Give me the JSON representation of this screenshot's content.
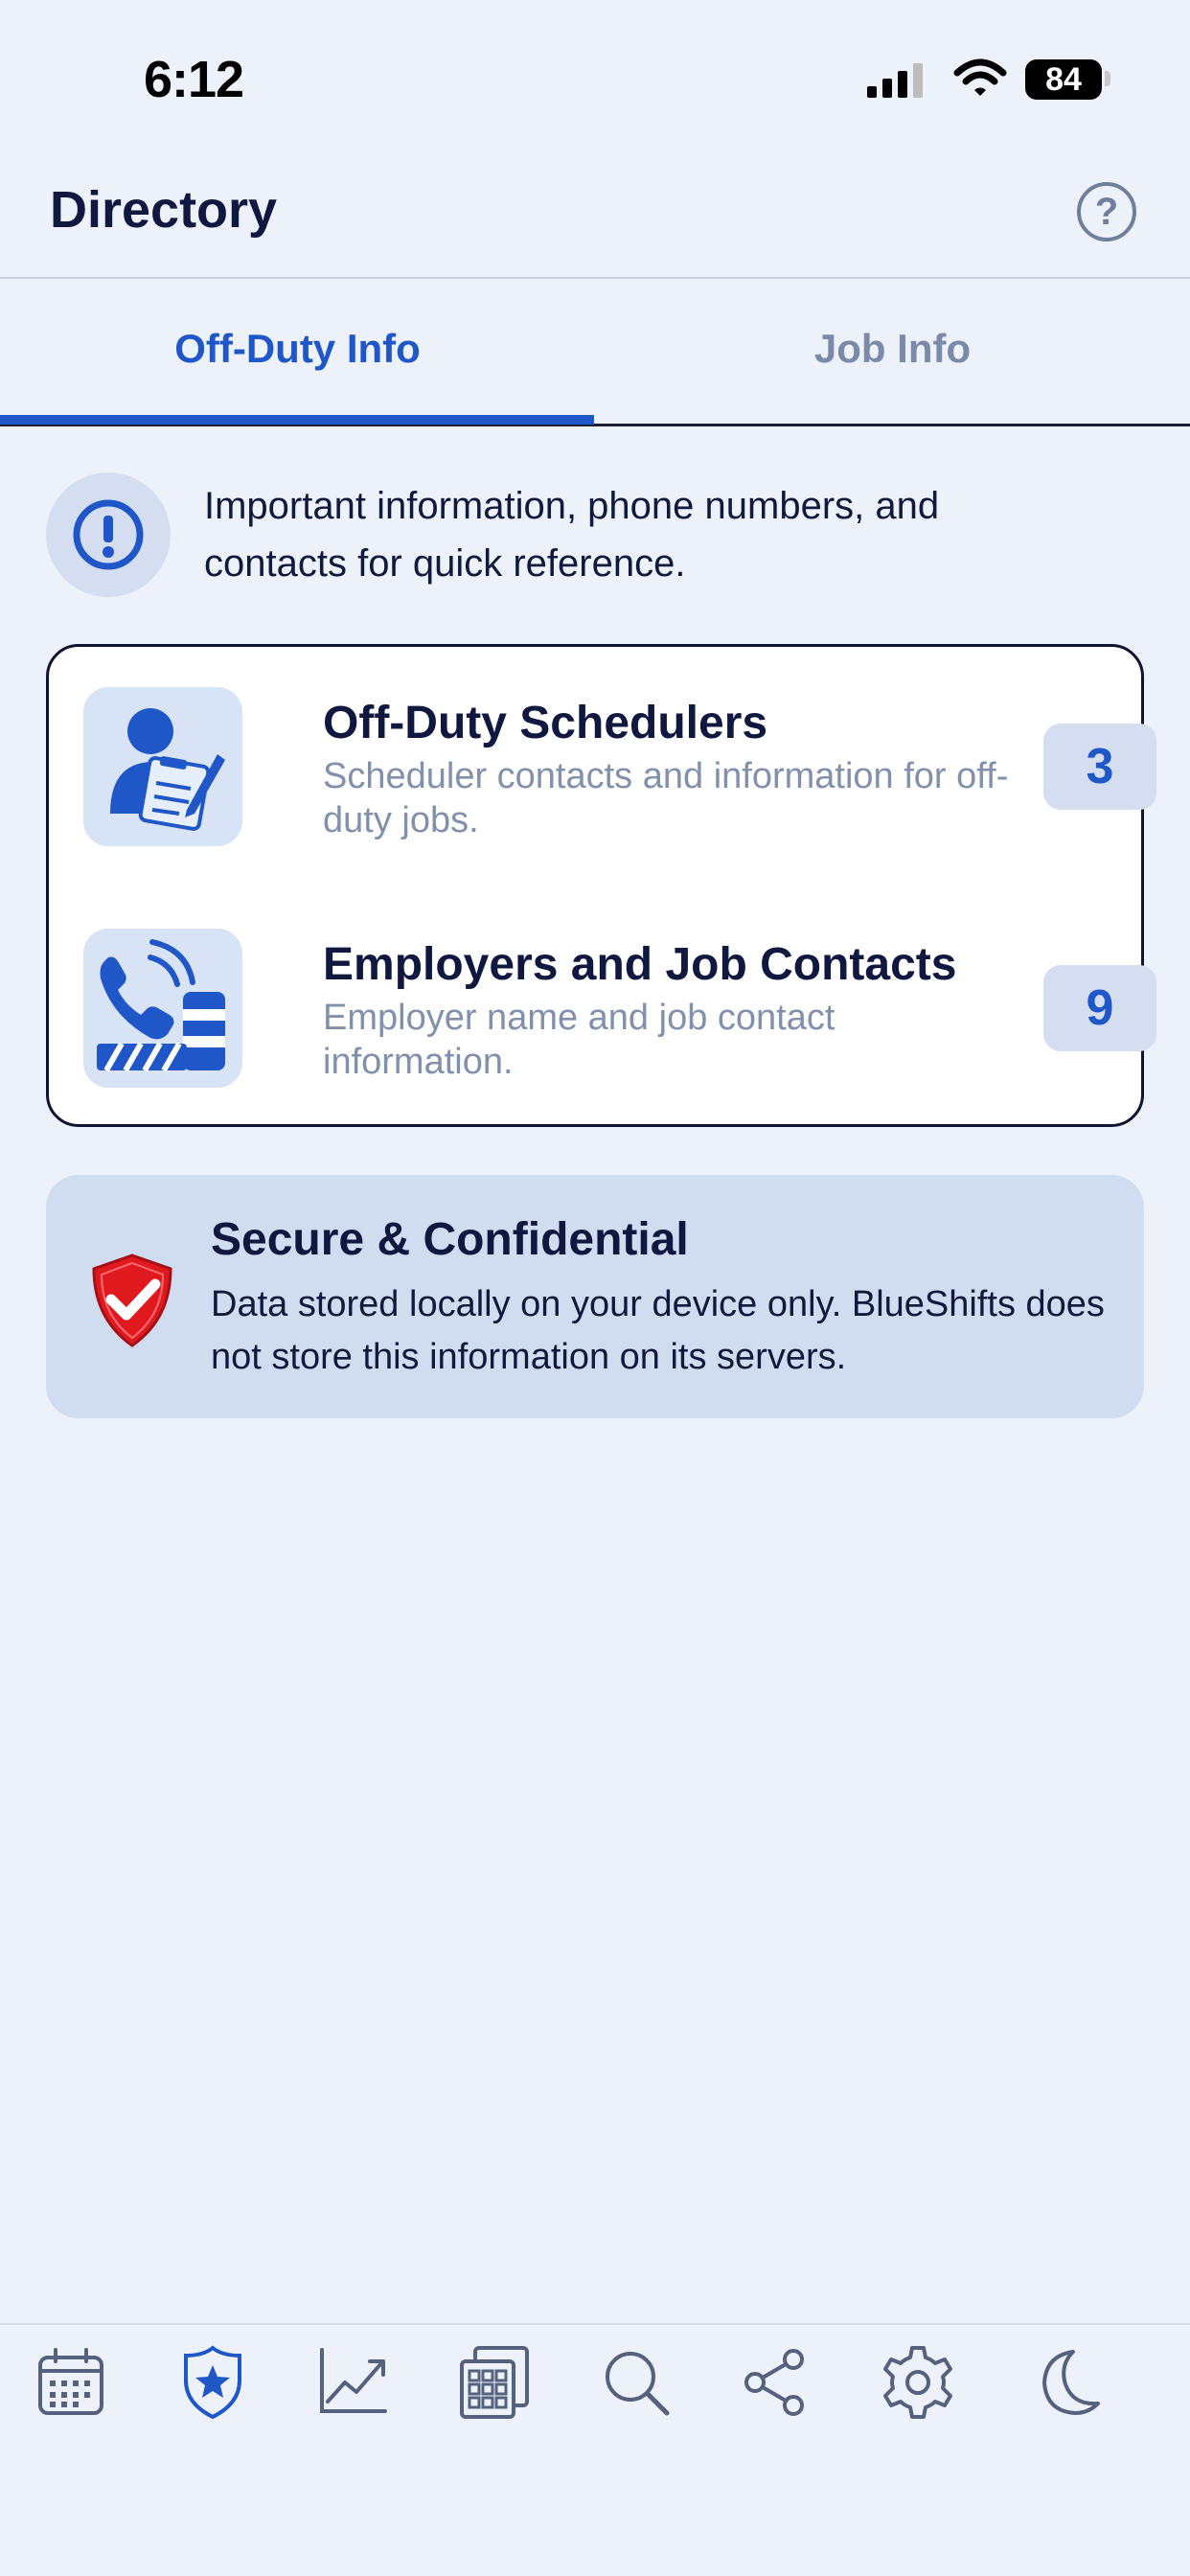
{
  "status_bar": {
    "time": "6:12",
    "battery": "84",
    "icons": [
      "signal-icon",
      "wifi-icon",
      "battery-icon"
    ]
  },
  "header": {
    "title": "Directory",
    "help_icon": "question-circle-icon"
  },
  "tabs": [
    {
      "label": "Off-Duty Info",
      "active": true
    },
    {
      "label": "Job Info",
      "active": false
    }
  ],
  "info_banner": {
    "icon": "exclamation-circle-icon",
    "text": "Important information, phone numbers, and contacts for quick reference."
  },
  "directory_items": [
    {
      "icon": "scheduler-clipboard-icon",
      "title": "Off-Duty Schedulers",
      "subtitle": "Scheduler contacts and information for off-duty jobs.",
      "count": "3"
    },
    {
      "icon": "phone-barricade-icon",
      "title": "Employers and Job Contacts",
      "subtitle": "Employer name and job contact information.",
      "count": "9"
    }
  ],
  "secure_notice": {
    "icon": "shield-check-icon",
    "title": "Secure & Confidential",
    "text": "Data stored locally on your device only. BlueShifts does not store this information on its servers."
  },
  "bottom_nav": [
    {
      "icon": "calendar-icon",
      "active": false
    },
    {
      "icon": "badge-star-icon",
      "active": true
    },
    {
      "icon": "chart-line-icon",
      "active": false
    },
    {
      "icon": "calculator-icon",
      "active": false
    },
    {
      "icon": "search-icon",
      "active": false
    },
    {
      "icon": "share-icon",
      "active": false
    },
    {
      "icon": "gear-icon",
      "active": false
    },
    {
      "icon": "moon-icon",
      "active": false
    }
  ],
  "colors": {
    "accent": "#1f56c8",
    "background": "#ecf1fa",
    "muted_text": "#8190ab",
    "shield_red": "#e0191f"
  }
}
